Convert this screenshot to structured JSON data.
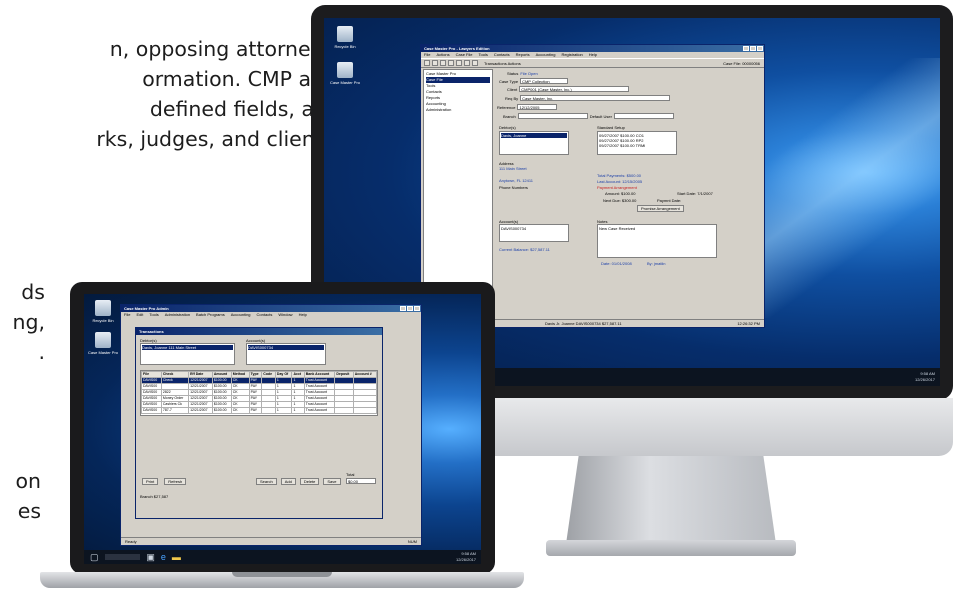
{
  "marketing": {
    "line1": "n, opposing attorneys,",
    "line2": "ormation.  CMP also",
    "line3": "defined fields, and",
    "line4": "rks, judges, and clients.",
    "frag1": "ds",
    "frag2": "ng,",
    "frag3": ".",
    "frag4": "on",
    "frag5": "es"
  },
  "desktop_icons": [
    "Recycle Bin",
    "Case Master Pro"
  ],
  "monitor_app": {
    "title": "Case Master Pro - Lawyers Edition",
    "menu": [
      "File",
      "Actions",
      "Case File",
      "Tools",
      "Contacts",
      "Reports",
      "Accounting",
      "Registration",
      "Help"
    ],
    "toolbar_text": "Transactions  Actions",
    "case_no": "Case File: 00000056",
    "tree": [
      "Case Master Pro",
      "Case File",
      "Tools",
      "Contacts",
      "Reports",
      "Accounting",
      "Administration"
    ],
    "status_label": "Status",
    "status_value": "File Open",
    "case_type_label": "Case Type",
    "case_type_value": "CMP Collection",
    "client_label": "Client",
    "client_value": "CMP001 (Case Master, Inc.)",
    "reqby_label": "Req By",
    "reqby_value": "Case Master, Inc.",
    "ref_label": "Reference",
    "ref_value": "12/12/2005",
    "branch_label": "Branch",
    "default_user_label": "Default User",
    "debtors_label": "Debtor(s)",
    "debtor_value": "Davis, Joanne",
    "trans_label": "Standard Setup",
    "trans_rows": [
      "09/27/2007  $100.00  CO1",
      "09/27/2007  $100.00  RP2",
      "09/27/2007  $100.00  TRMI"
    ],
    "address_label": "Address",
    "address_lines": [
      "111 Main Street",
      "Anytown, FL 12411"
    ],
    "phone_label": "Phone Numbers",
    "total_payments": "Total Payments:  $500.00",
    "last_account": "Last Account:  12/15/2005",
    "payment_label": "Payment Arrangement",
    "amount": "Amount:  $100.00",
    "start_date": "Start Date:  7/1/2007",
    "next_due": "Next Due:  $300.00",
    "payment_date": "Paymnt Date:",
    "prom_btn": "Promise Arrangement",
    "accounts_label": "Account(s)",
    "account_value": "DAVIS000734",
    "current_balance": "Current Balance:  $27,587.11",
    "notes_label": "Notes",
    "note_value": "New Case Received",
    "date_label": "Date:  01/01/2008",
    "by_label": "By:  jmatlin",
    "statusbar": "Davis Jr. Joanne  DAVIS000734  $27,587.11",
    "statusbar_time": "12:26:32 PM"
  },
  "monitor_taskbar": {
    "time": "9:58 AM",
    "date": "12/26/2017"
  },
  "laptop_app": {
    "title": "Case Master Pro Admin",
    "menu": [
      "File",
      "Edit",
      "Tools",
      "Administration",
      "Batch Programs",
      "Accounting",
      "Contacts",
      "Window",
      "Help"
    ],
    "subwindow": "Transactions",
    "debtors_label": "Debtor(s)",
    "debtor_value": "Davis, Joanne  111 Main Street",
    "accounts_label": "Account(s)",
    "account_value": "DAVIS000734",
    "ledger_columns": [
      "File",
      "Check",
      "Eff Date",
      "Amount",
      "Method",
      "Type",
      "Code",
      "Day Of",
      "Acct",
      "Bank Account",
      "Deposit",
      "Account #"
    ],
    "ledger_rows": [
      [
        "DAVIS00",
        "Check",
        "12/21/2007",
        "$100.00",
        "CK",
        "PAY",
        "",
        "1",
        "1",
        "Trust Account",
        "",
        ""
      ],
      [
        "DAVIS00",
        "",
        "12/21/2007",
        "$100.00",
        "CK",
        "PAY",
        "",
        "1",
        "1",
        "Trust Account",
        "",
        ""
      ],
      [
        "DAVIS00",
        "2822",
        "12/21/2007",
        "$100.00",
        "CK",
        "PAY",
        "",
        "1",
        "1",
        "Trust Account",
        "",
        ""
      ],
      [
        "DAVIS00",
        "Money Order",
        "12/21/2007",
        "$100.00",
        "CK",
        "PAY",
        "",
        "1",
        "1",
        "Trust Account",
        "",
        ""
      ],
      [
        "DAVIS00",
        "Cashiers Ck",
        "12/21/2007",
        "$100.00",
        "CK",
        "PAY",
        "",
        "1",
        "1",
        "Trust Account",
        "",
        ""
      ],
      [
        "DAVIS00",
        "787-7",
        "12/21/2007",
        "$100.00",
        "CK",
        "PAY",
        "",
        "1",
        "1",
        "Trust Account",
        "",
        ""
      ]
    ],
    "btn_print": "Print",
    "btn_refresh": "Refresh",
    "btn_search": "Search",
    "btn_add": "Add",
    "btn_delete": "Delete",
    "btn_save": "Save",
    "total_label": "Total",
    "total_value": "$0.00",
    "bottom_left": "Branch  $27,587",
    "status_left": "Ready",
    "status_right": "NUM"
  }
}
